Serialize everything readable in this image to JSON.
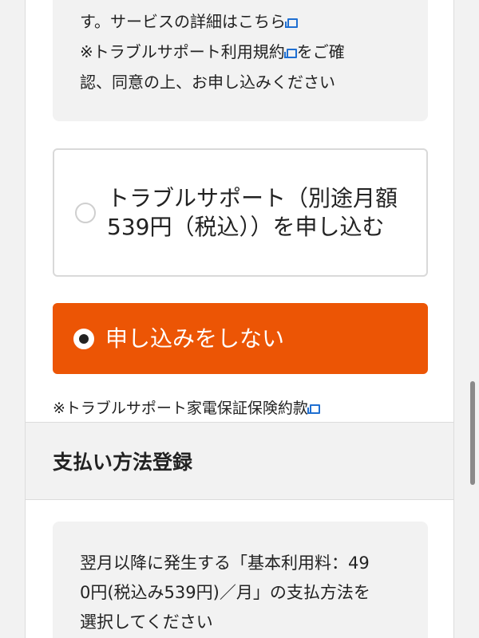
{
  "service_info": {
    "line1": "す。サービスの詳細はこちら",
    "line2_prefix": "※トラブルサポート利用規約",
    "line2_suffix": "をご確",
    "line3": "認、同意の上、お申し込みください"
  },
  "options": {
    "apply_label": "トラブルサポート（別途月額539円（税込））を申し込む",
    "decline_label": "申し込みをしない",
    "selected": "decline"
  },
  "warranty_note": "※トラブルサポート家電保証保険約款",
  "payment_section": {
    "title": "支払い方法登録",
    "line1": "翌月以降に発生する「基本利用料：49",
    "line2": "0円(税込み539円)／月」の支払方法を",
    "line3": "選択してください"
  },
  "colors": {
    "accent": "#ec5505",
    "link_icon": "#1f6fd1",
    "panel_bg": "#f2f2f2"
  },
  "icons": {
    "external_link": "external-link-icon",
    "radio_unselected": "radio-unselected-icon",
    "radio_selected": "radio-selected-icon"
  }
}
